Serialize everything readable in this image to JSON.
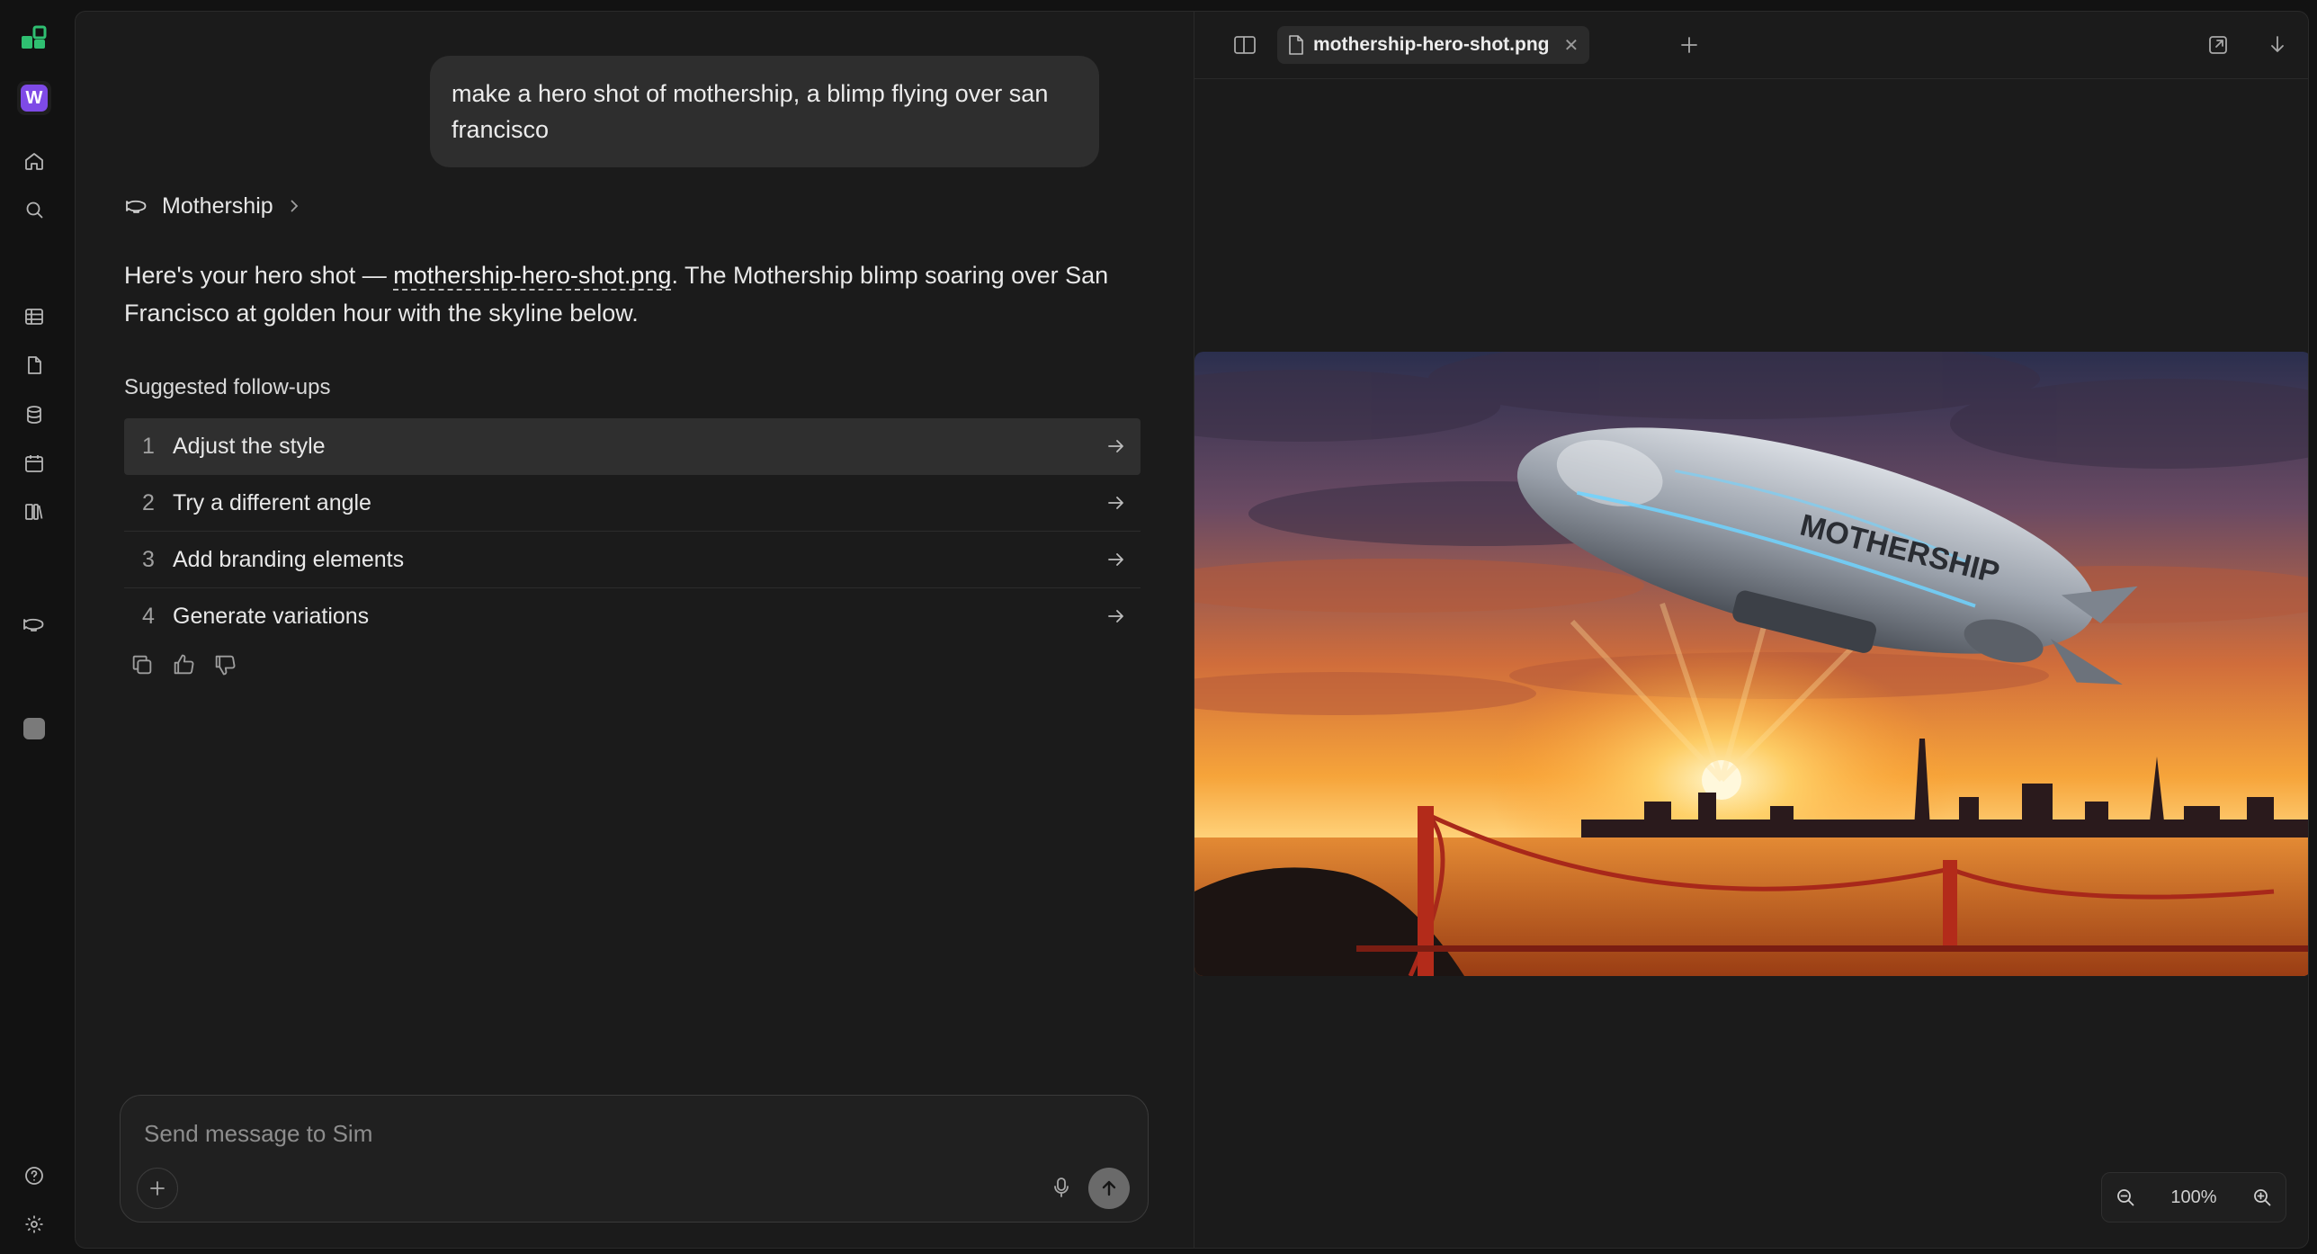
{
  "user_message": "make a hero shot of mothership, a blimp flying over san francisco",
  "agent": {
    "name": "Mothership"
  },
  "reply": {
    "prefix": "Here's your hero shot — ",
    "link": "mothership-hero-shot.png",
    "suffix": ". The Mothership blimp soaring over San Francisco at golden hour with the skyline below."
  },
  "followups": {
    "title": "Suggested follow-ups",
    "items": [
      {
        "num": "1",
        "label": "Adjust the style"
      },
      {
        "num": "2",
        "label": "Try a different angle"
      },
      {
        "num": "3",
        "label": "Add branding elements"
      },
      {
        "num": "4",
        "label": "Generate variations"
      }
    ]
  },
  "composer": {
    "placeholder": "Send message to Sim"
  },
  "sidebar": {
    "workspace_initial": "W"
  },
  "preview": {
    "tab_name": "mothership-hero-shot.png",
    "zoom": "100%",
    "blimp_text": "MOTHERSHIP"
  },
  "colors": {
    "accent_purple": "#7e4ae6",
    "logo_green": "#2fbf71",
    "background": "#1b1b1b"
  }
}
